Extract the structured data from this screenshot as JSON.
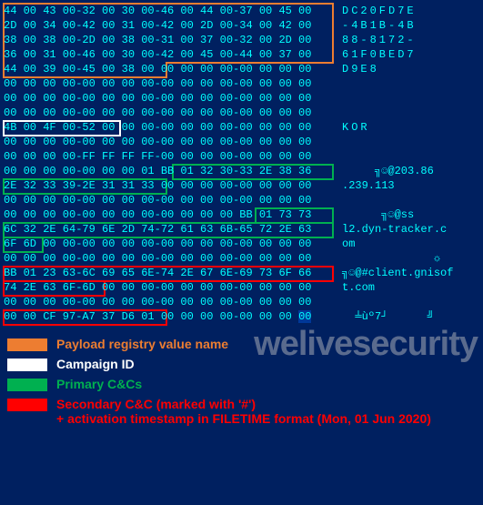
{
  "hex": {
    "rows": [
      {
        "b": "44 00 43 00-32 00 30 00-46 00 44 00-37 00 45 00",
        "a": "DC20FD7E"
      },
      {
        "b": "2D 00 34 00-42 00 31 00-42 00 2D 00-34 00 42 00",
        "a": "-4B1B-4B"
      },
      {
        "b": "38 00 38 00-2D 00 38 00-31 00 37 00-32 00 2D 00",
        "a": "88-8172-"
      },
      {
        "b": "36 00 31 00-46 00 30 00-42 00 45 00-44 00 37 00",
        "a": "61F0BED7"
      },
      {
        "b": "44 00 39 00-45 00 38 00",
        "b2": " 00 00 00 00-00 00 00 00",
        "a": "D9E8"
      },
      {
        "b": "00 00 00 00-00 00 00 00-00 00 00 00-00 00 00 00",
        "a": ""
      },
      {
        "b": "00 00 00 00-00 00 00 00-00 00 00 00-00 00 00 00",
        "a": ""
      },
      {
        "b": "00 00 00 00-00 00 00 00-00 00 00 00-00 00 00 00",
        "a": ""
      },
      {
        "b": "4B 00 4F 00-52 00",
        "b2": " 00 00-00 00 00 00-00 00 00 00",
        "a": "KOR"
      },
      {
        "b": "00 00 00 00-00 00 00 00-00 00 00 00-00 00 00 00",
        "a": ""
      },
      {
        "b": "00 00 00 00-FF FF FF FF-00 00 00 00-00 00 00 00",
        "a": ""
      },
      {
        "b": "00 00 00 00-00 00 00 01 ",
        "b2": "BB 01 32 30-33 2E 38 36",
        "a": "     ╗☺@203.86"
      },
      {
        "b": "2E 32 33 39-2E 31 31 33",
        "b2": " 00 00 00 00-00 00 00 00",
        "a": ".239.113"
      },
      {
        "b": "00 00 00 00-00 00 00 00-00 00 00 00-00 00 00 00",
        "a": ""
      },
      {
        "b": "00 00 00 00-00 00 00 00-00 00 00 00 ",
        "b2": "BB 01 73 73",
        "a": "      ╗☺@ss"
      },
      {
        "b": "6C 32 2E 64-79 6E 2D 74-72 61 63 6B-65 72 2E 63",
        "a": "l2.dyn-tracker.c"
      },
      {
        "b": "6F 6D",
        "b2": " 00 00-00 00 00 00-00 00 00 00-00 00 00 00",
        "a": "om"
      },
      {
        "b": "00 00 00 00-00 00 00 00-00 00 00 00-00 00 00 00",
        "a": "              ☼"
      },
      {
        "b": "BB 01 23 63-6C 69 65 6E-74 2E 67 6E-69 73 6F 66",
        "a": "╗☺@#client.gnisof"
      },
      {
        "b": "74 2E 63 6F-6D",
        "b2": " 00 00 00-00 00 00 00-00 00 00 00",
        "a": "t.com"
      },
      {
        "b": "00 00 00 00-00 00 00 00-00 00 00 00-00 00 00 00",
        "a": ""
      },
      {
        "b": "00 00 CF 97-A7 37 D6 01",
        "b2": " 00 00 00 00-00 00 00 ",
        "b3": "00",
        "a": "  ╧ùº7┘      ╝"
      }
    ]
  },
  "legend": {
    "orange": "Payload registry value name",
    "white": "Campaign ID",
    "green": "Primary C&Cs",
    "red": "Secondary C&C (marked with '#')\n+ activation timestamp in FILETIME format (Mon, 01 Jun 2020)"
  },
  "watermark": "welivesecurity"
}
